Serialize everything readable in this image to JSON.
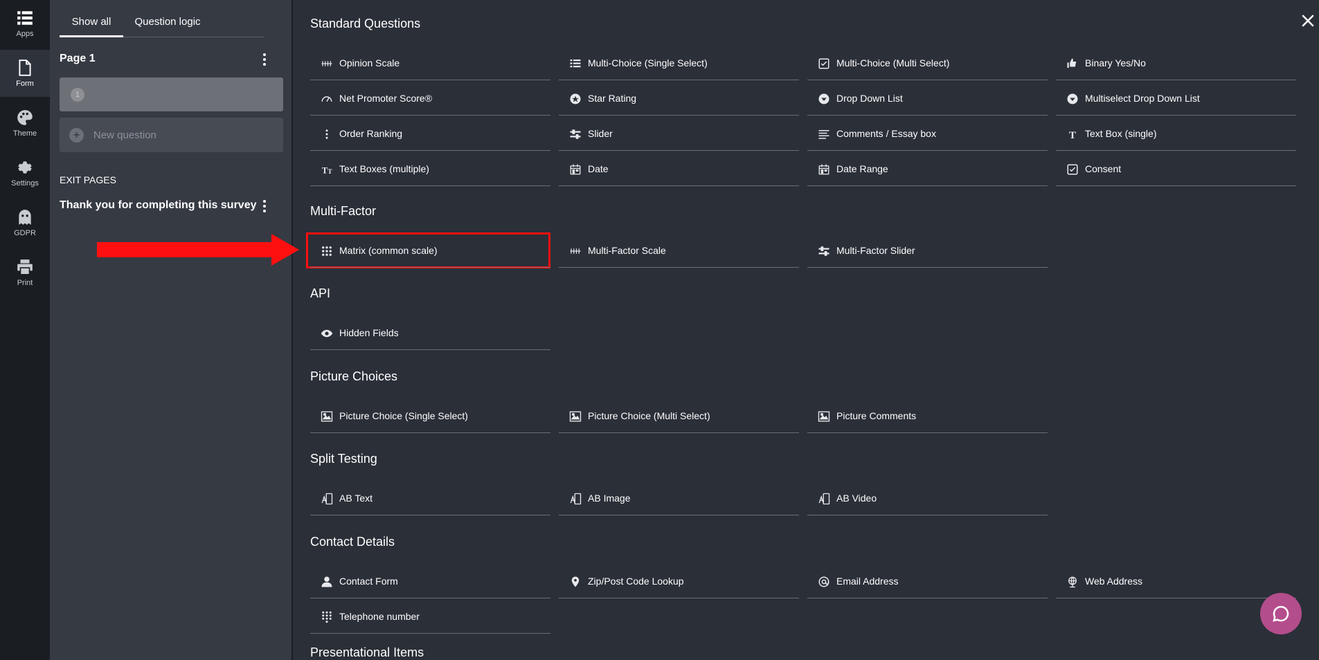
{
  "rail": {
    "items": [
      {
        "label": "Apps",
        "icon": "apps-icon"
      },
      {
        "label": "Form",
        "icon": "form-icon"
      },
      {
        "label": "Theme",
        "icon": "palette-icon"
      },
      {
        "label": "Settings",
        "icon": "gear-icon"
      },
      {
        "label": "GDPR",
        "icon": "ghost-icon"
      },
      {
        "label": "Print",
        "icon": "printer-icon"
      }
    ]
  },
  "pages_panel": {
    "tabs": [
      "Show all",
      "Question logic"
    ],
    "page_title": "Page 1",
    "question_number": "1",
    "new_question": "New question",
    "exit_heading": "EXIT PAGES",
    "exit_page": "Thank you for completing this survey"
  },
  "sections": [
    {
      "title": "Standard Questions",
      "items": [
        {
          "label": "Opinion Scale",
          "icon": "scale-icon"
        },
        {
          "label": "Multi-Choice (Single Select)",
          "icon": "list-icon"
        },
        {
          "label": "Multi-Choice (Multi Select)",
          "icon": "checkbox-icon"
        },
        {
          "label": "Binary Yes/No",
          "icon": "thumbs-icon"
        },
        {
          "label": "Net Promoter Score®",
          "icon": "gauge-icon"
        },
        {
          "label": "Star Rating",
          "icon": "star-icon"
        },
        {
          "label": "Drop Down List",
          "icon": "dropdown-icon"
        },
        {
          "label": "Multiselect Drop Down List",
          "icon": "dropdown-icon"
        },
        {
          "label": "Order Ranking",
          "icon": "ranking-icon"
        },
        {
          "label": "Slider",
          "icon": "slider-icon"
        },
        {
          "label": "Comments / Essay box",
          "icon": "paragraph-icon"
        },
        {
          "label": "Text Box (single)",
          "icon": "text-icon"
        },
        {
          "label": "Text Boxes (multiple)",
          "icon": "text-multi-icon"
        },
        {
          "label": "Date",
          "icon": "calendar-icon"
        },
        {
          "label": "Date Range",
          "icon": "calendar-icon"
        },
        {
          "label": "Consent",
          "icon": "checkbox-icon"
        }
      ]
    },
    {
      "title": "Multi-Factor",
      "items": [
        {
          "label": "Matrix (common scale)",
          "icon": "grid-icon"
        },
        {
          "label": "Multi-Factor Scale",
          "icon": "scale-icon"
        },
        {
          "label": "Multi-Factor Slider",
          "icon": "slider-icon"
        }
      ]
    },
    {
      "title": "API",
      "items": [
        {
          "label": "Hidden Fields",
          "icon": "eye-icon"
        }
      ]
    },
    {
      "title": "Picture Choices",
      "items": [
        {
          "label": "Picture Choice (Single Select)",
          "icon": "picture-icon"
        },
        {
          "label": "Picture Choice (Multi Select)",
          "icon": "picture-icon"
        },
        {
          "label": "Picture Comments",
          "icon": "picture-icon"
        }
      ]
    },
    {
      "title": "Split Testing",
      "items": [
        {
          "label": "AB Text",
          "icon": "ab-icon"
        },
        {
          "label": "AB Image",
          "icon": "ab-icon"
        },
        {
          "label": "AB Video",
          "icon": "ab-icon"
        }
      ]
    },
    {
      "title": "Contact Details",
      "items": [
        {
          "label": "Contact Form",
          "icon": "person-icon"
        },
        {
          "label": "Zip/Post Code Lookup",
          "icon": "pin-icon"
        },
        {
          "label": "Email Address",
          "icon": "at-icon"
        },
        {
          "label": "Web Address",
          "icon": "globe-icon"
        },
        {
          "label": "Telephone number",
          "icon": "keypad-icon"
        }
      ]
    },
    {
      "title": "Presentational Items",
      "items": []
    }
  ],
  "colors": {
    "highlight": "#ff1010",
    "chat_button": "#b34d8c"
  }
}
